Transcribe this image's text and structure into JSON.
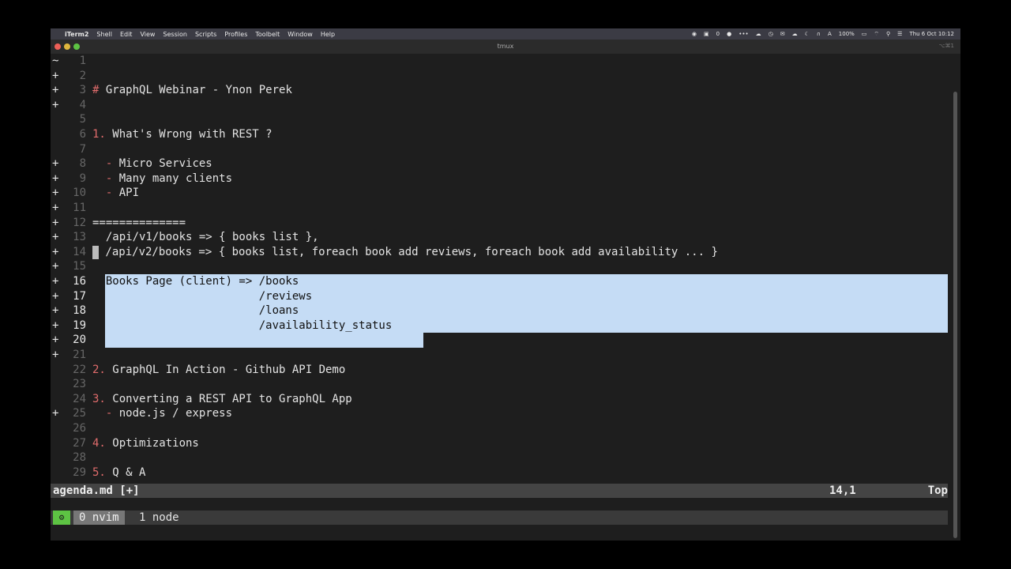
{
  "menubar": {
    "app": "iTerm2",
    "menus": [
      "Shell",
      "Edit",
      "View",
      "Session",
      "Scripts",
      "Profiles",
      "Toolbelt",
      "Window",
      "Help"
    ],
    "counter": "0",
    "battery": "100%",
    "datetime": "Thu 6 Oct  10:12"
  },
  "window": {
    "title": "tmux",
    "shortcut": "⌥⌘1"
  },
  "editor": {
    "cursor_position": "14,1",
    "scroll": "Top",
    "filename": "agenda.md [+]",
    "lines": [
      {
        "sign": "~",
        "num": "1",
        "text": ""
      },
      {
        "sign": "+",
        "num": "2",
        "text": ""
      },
      {
        "sign": "+",
        "num": "3",
        "mark": "#",
        "text": " GraphQL Webinar - Ynon Perek"
      },
      {
        "sign": "+",
        "num": "4",
        "text": ""
      },
      {
        "sign": "",
        "num": "5",
        "text": ""
      },
      {
        "sign": "",
        "num": "6",
        "mark": "1.",
        "text": " What's Wrong with REST ?"
      },
      {
        "sign": "",
        "num": "7",
        "text": ""
      },
      {
        "sign": "+",
        "num": "8",
        "mark": "  -",
        "text": " Micro Services"
      },
      {
        "sign": "+",
        "num": "9",
        "mark": "  -",
        "text": " Many many clients"
      },
      {
        "sign": "+",
        "num": "10",
        "mark": "  -",
        "text": " API"
      },
      {
        "sign": "+",
        "num": "11",
        "text": ""
      },
      {
        "sign": "+",
        "num": "12",
        "text": "=============="
      },
      {
        "sign": "+",
        "num": "13",
        "text": "  /api/v1/books => { books list },"
      },
      {
        "sign": "+",
        "num": "14",
        "cursor": true,
        "text": " /api/v2/books => { books list, foreach book add reviews, foreach book add availability ... }"
      },
      {
        "sign": "+",
        "num": "15",
        "text": ""
      },
      {
        "sign": "+",
        "num": "16",
        "selected": true,
        "text": "  Books Page (client) => /books"
      },
      {
        "sign": "+",
        "num": "17",
        "selected": true,
        "text": "                         /reviews"
      },
      {
        "sign": "+",
        "num": "18",
        "selected": true,
        "text": "                         /loans"
      },
      {
        "sign": "+",
        "num": "19",
        "selected": true,
        "text": "                         /availability_status"
      },
      {
        "sign": "+",
        "num": "20",
        "selected": true,
        "partial": true,
        "text": ""
      },
      {
        "sign": "+",
        "num": "21",
        "text": ""
      },
      {
        "sign": "",
        "num": "22",
        "mark": "2.",
        "text": " GraphQL In Action - Github API Demo"
      },
      {
        "sign": "",
        "num": "23",
        "text": ""
      },
      {
        "sign": "",
        "num": "24",
        "mark": "3.",
        "text": " Converting a REST API to GraphQL App"
      },
      {
        "sign": "+",
        "num": "25",
        "mark": "  -",
        "text": " node.js / express"
      },
      {
        "sign": "",
        "num": "26",
        "text": ""
      },
      {
        "sign": "",
        "num": "27",
        "mark": "4.",
        "text": " Optimizations"
      },
      {
        "sign": "",
        "num": "28",
        "text": ""
      },
      {
        "sign": "",
        "num": "29",
        "mark": "5.",
        "text": " Q & A"
      }
    ]
  },
  "tmux": {
    "icon": "⚙",
    "window0": "0 nvim",
    "window1": "1 node"
  },
  "colors": {
    "selection": "#c5dcf5",
    "markdown_marker": "#e06c6c",
    "tmux_accent": "#5dc343"
  }
}
